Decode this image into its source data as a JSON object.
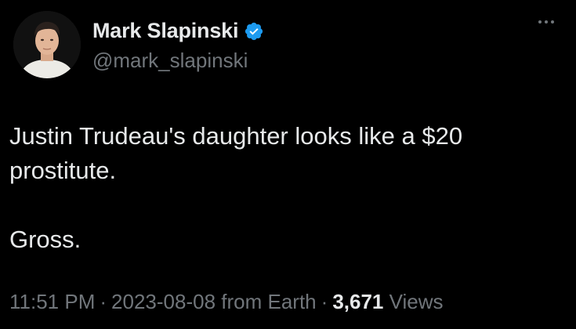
{
  "author": {
    "display_name": "Mark Slapinski",
    "handle": "@mark_slapinski",
    "verified": true,
    "verified_color": "#1d9bf0"
  },
  "tweet": {
    "lines": [
      "Justin Trudeau's daughter looks like a $20",
      "prostitute.",
      "Gross."
    ]
  },
  "meta": {
    "time": "11:51 PM",
    "date": "2023-08-08",
    "source": "from Earth",
    "views_count": "3,671",
    "views_label": "Views",
    "separator": "·"
  },
  "icons": {
    "more": "more-icon",
    "verified": "verified-badge-icon"
  }
}
